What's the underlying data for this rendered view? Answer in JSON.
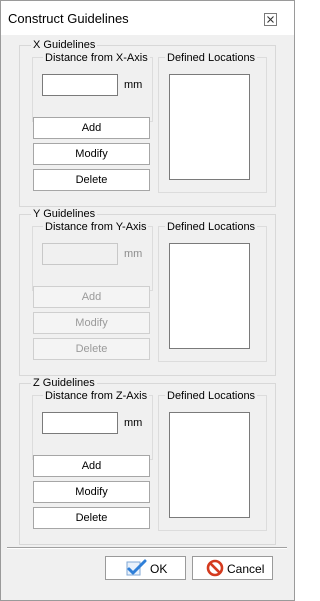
{
  "window": {
    "title": "Construct Guidelines"
  },
  "groups": {
    "x": {
      "label": "X Guidelines",
      "distance_label": "Distance from X-Axis",
      "distance_value": "",
      "unit": "mm",
      "defined_label": "Defined Locations",
      "add": "Add",
      "modify": "Modify",
      "delete": "Delete",
      "enabled": true
    },
    "y": {
      "label": "Y Guidelines",
      "distance_label": "Distance from Y-Axis",
      "distance_value": "",
      "unit": "mm",
      "defined_label": "Defined Locations",
      "add": "Add",
      "modify": "Modify",
      "delete": "Delete",
      "enabled": false
    },
    "z": {
      "label": "Z Guidelines",
      "distance_label": "Distance from Z-Axis",
      "distance_value": "",
      "unit": "mm",
      "defined_label": "Defined Locations",
      "add": "Add",
      "modify": "Modify",
      "delete": "Delete",
      "enabled": true
    }
  },
  "footer": {
    "ok_label": "OK",
    "cancel_label": "Cancel"
  },
  "icons": {
    "ok": "checkmark-icon",
    "cancel": "prohibited-icon",
    "close": "close-icon"
  },
  "colors": {
    "ok_check": "#2f7fd8",
    "cancel_red": "#d43a1e"
  }
}
